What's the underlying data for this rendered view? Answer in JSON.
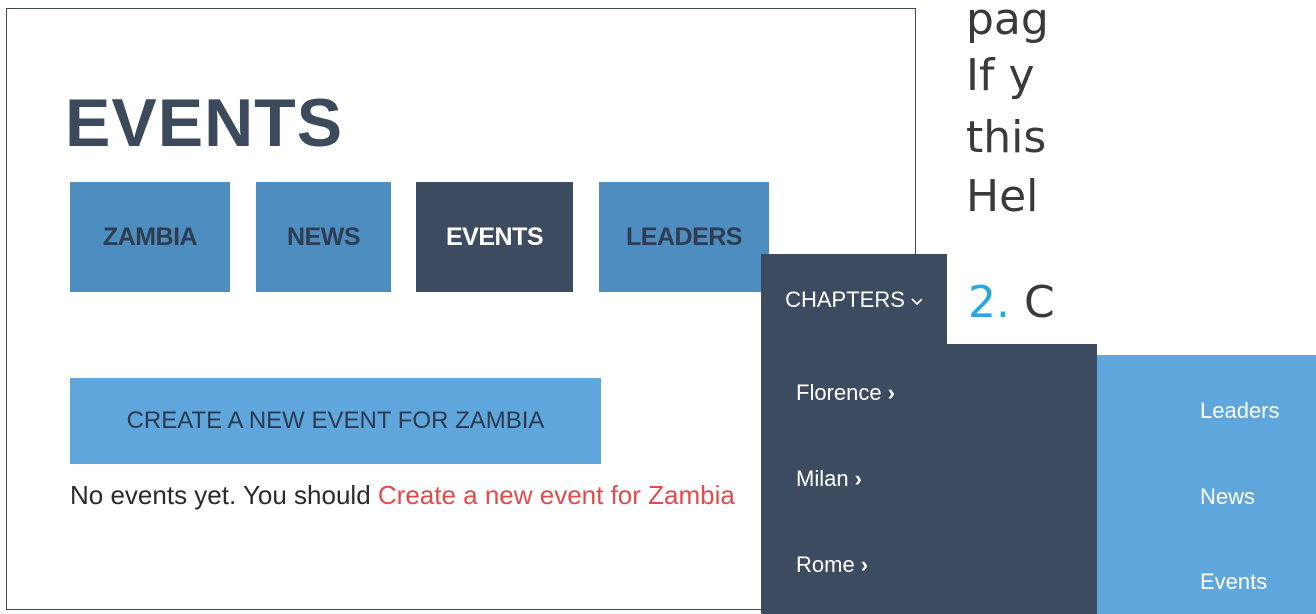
{
  "page": {
    "title": "EVENTS",
    "tabs": [
      {
        "label": "ZAMBIA",
        "active": false
      },
      {
        "label": "NEWS",
        "active": false
      },
      {
        "label": "EVENTS",
        "active": true
      },
      {
        "label": "LEADERS",
        "active": false
      }
    ],
    "create_button_label": "CREATE A NEW EVENT FOR ZAMBIA",
    "empty_message": "No events yet. You should ",
    "empty_link": "Create a new event for Zambia"
  },
  "chapters_menu": {
    "button_label": "CHAPTERS",
    "button_icon": "chevron-down-icon",
    "items": [
      {
        "label": "Florence",
        "arrow": "›"
      },
      {
        "label": "Milan",
        "arrow": "›"
      },
      {
        "label": "Rome",
        "arrow": "›"
      }
    ]
  },
  "side_nav": {
    "items": [
      {
        "label": "Leaders"
      },
      {
        "label": "News"
      },
      {
        "label": "Events"
      }
    ]
  },
  "slide_text": {
    "lines": [
      "pag",
      "If y",
      "this",
      "Hel"
    ],
    "step_number": "2.",
    "step_text": "C"
  },
  "colors": {
    "tab_inactive": "#4e8dbf",
    "tab_active": "#3c4b5f",
    "button": "#5fa6dc",
    "link": "#e24b4b",
    "dropdown": "#3c4b5f",
    "side_nav": "#5fa6dc",
    "step_number": "#29a8e0"
  }
}
